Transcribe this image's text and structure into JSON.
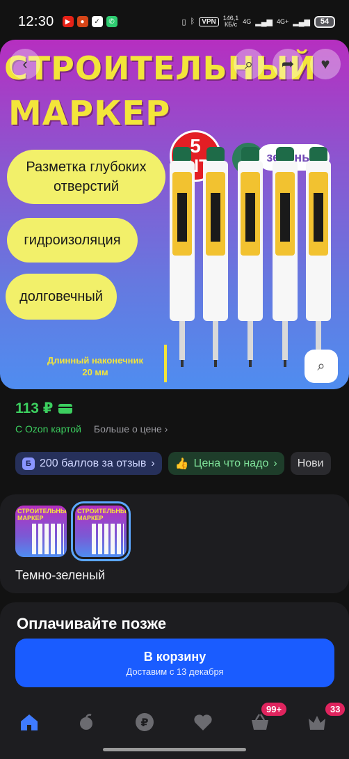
{
  "status_bar": {
    "time": "12:30",
    "vpn": "VPN",
    "speed_value": "146,1",
    "speed_unit": "КБ/с",
    "net1": "4G",
    "net2": "4G+",
    "battery": "54"
  },
  "hero": {
    "title_line1": "СТРОИТЕЛЬНЫЙ",
    "title_line2": "МАРКЕР",
    "count_number": "5",
    "count_unit": "ШТ",
    "color_name": "зеленый",
    "pills": [
      "Разметка глубоких отверстий",
      "гидроизоляция",
      "долговечный"
    ],
    "note_line1": "Длинный наконечник",
    "note_line2": "20 мм",
    "colors": {
      "accent_yellow": "#f3e53a",
      "marker_cap": "#1e6b48"
    }
  },
  "price": {
    "value": "113 ₽",
    "ozon_card": "С Ozon картой",
    "more": "Больше о цене"
  },
  "chips": [
    {
      "label": "200 баллов за отзыв",
      "badge": "Б"
    },
    {
      "label": "Цена что надо"
    },
    {
      "label": "Нови"
    }
  ],
  "variant": {
    "label": "Темно-зеленый",
    "thumb_title_1": "СТРОИТЕЛЬНЫЙ",
    "thumb_title_2": "МАРКЕР"
  },
  "pay_later": {
    "title": "Оплачивайте позже",
    "cart_label": "В корзину",
    "cart_sub": "Доставим с 13 декабря"
  },
  "nav": {
    "cart_badge": "99+",
    "profile_badge": "33"
  }
}
